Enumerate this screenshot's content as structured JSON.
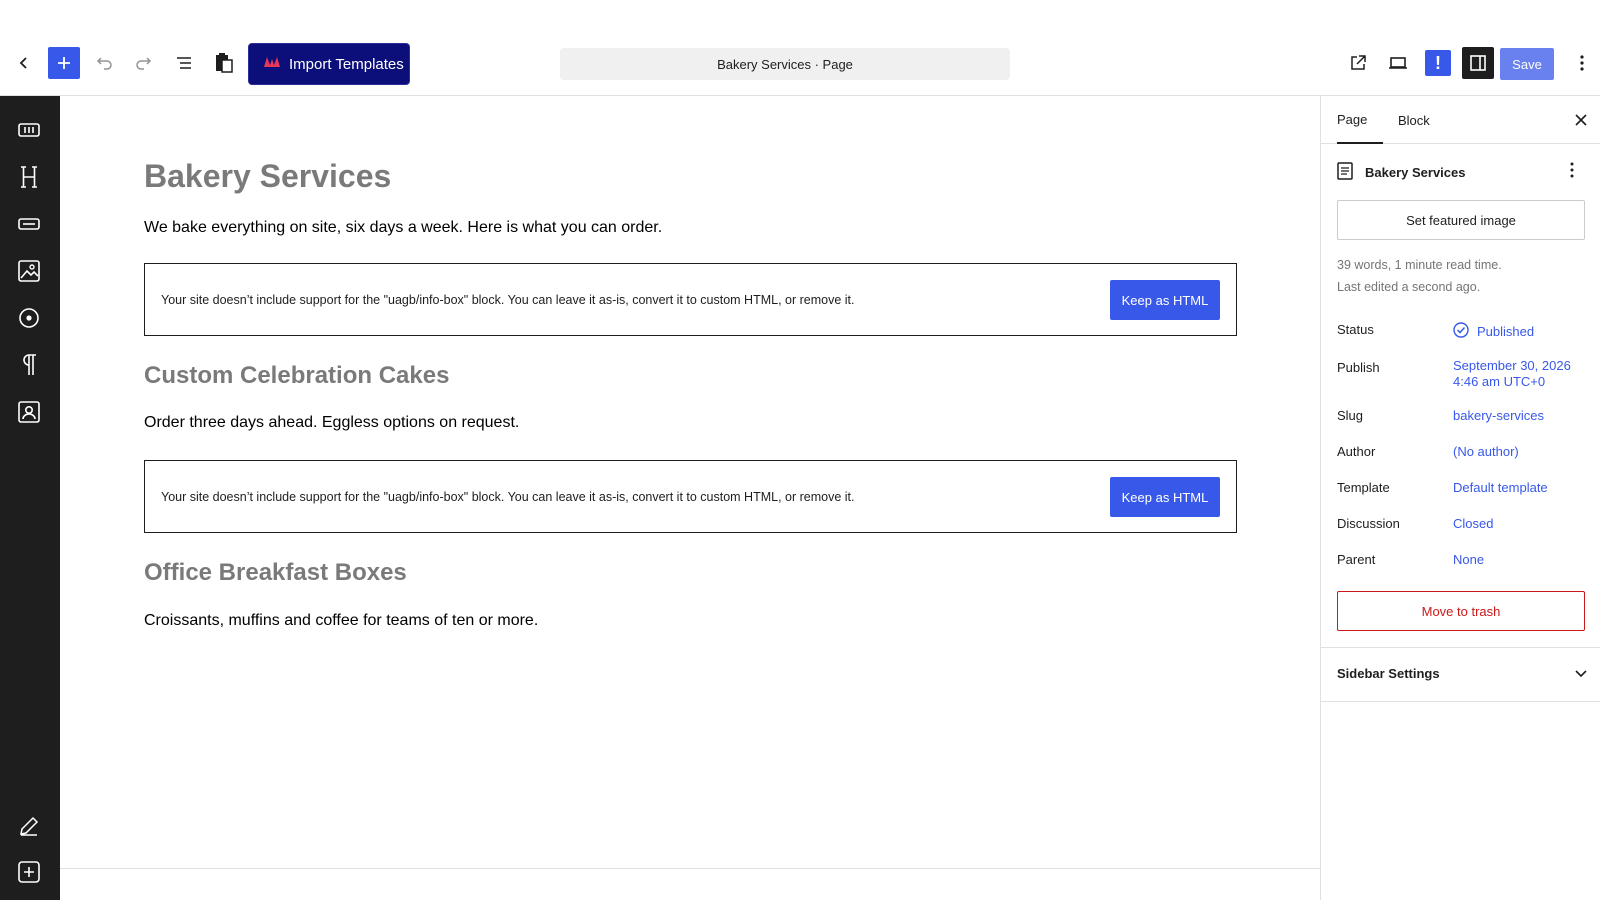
{
  "toolbar": {
    "import_label": "Import Templates",
    "document_title": "Bakery Services · Page",
    "save_label": "Save",
    "yoast_label": "!"
  },
  "content": {
    "title": "Bakery Services",
    "intro": "We bake everything on site, six days a week. Here is what you can order.",
    "warning_text": "Your site doesn’t include support for the \"uagb/info-box\" block. You can leave it as-is, convert it to custom HTML, or remove it.",
    "keep_label": "Keep as HTML",
    "section1_title": "Custom Celebration Cakes",
    "section1_text": "Order three days ahead. Eggless options on request.",
    "section2_title": "Office Breakfast Boxes",
    "section2_text": "Croissants, muffins and coffee for teams of ten or more."
  },
  "panel": {
    "tab_page": "Page",
    "tab_block": "Block",
    "doc_title": "Bakery Services",
    "featured_image": "Set featured image",
    "word_count": "39 words, 1 minute read time.",
    "last_edited": "Last edited a second ago.",
    "status_label": "Status",
    "status_value": "Published",
    "publish_label": "Publish",
    "publish_date": "September 30, 2026",
    "publish_time": "4:46 am UTC+0",
    "slug_label": "Slug",
    "slug_value": "bakery-services",
    "author_label": "Author",
    "author_value": "(No author)",
    "template_label": "Template",
    "template_value": "Default template",
    "discussion_label": "Discussion",
    "discussion_value": "Closed",
    "parent_label": "Parent",
    "parent_value": "None",
    "trash_label": "Move to trash",
    "sidebar_settings": "Sidebar Settings"
  }
}
